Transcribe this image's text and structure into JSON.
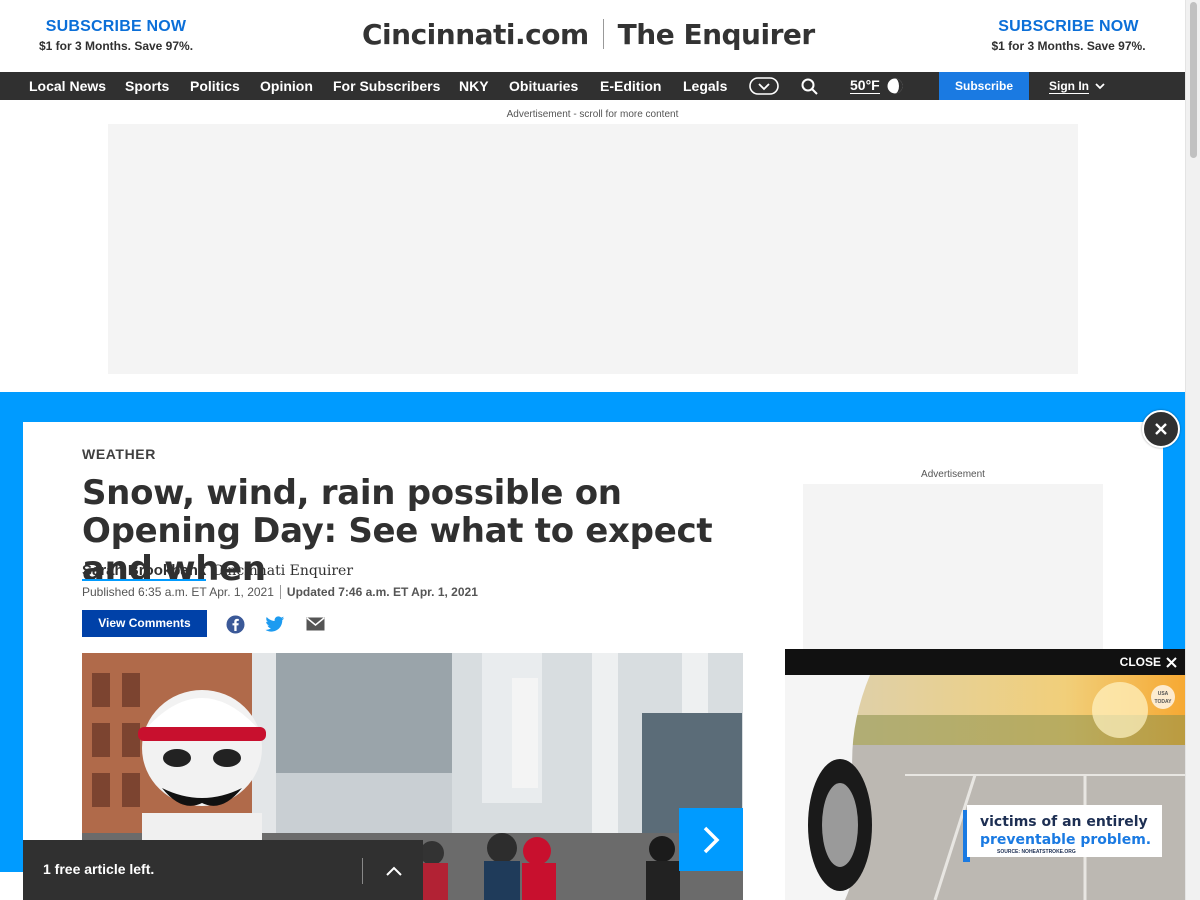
{
  "masthead": {
    "promo_left": {
      "title": "SUBSCRIBE NOW",
      "subtitle": "$1 for 3 Months. Save 97%."
    },
    "promo_right": {
      "title": "SUBSCRIBE NOW",
      "subtitle": "$1 for 3 Months. Save 97%."
    },
    "brand_primary": "Cincinnati.com",
    "brand_secondary": "The Enquirer"
  },
  "nav": {
    "items": [
      "Local News",
      "Sports",
      "Politics",
      "Opinion",
      "For Subscribers",
      "NKY",
      "Obituaries",
      "E-Edition",
      "Legals"
    ],
    "more_icon": "more-toggle-icon",
    "search_icon": "search-icon",
    "weather": {
      "temp": "50°F",
      "icon": "partly-cloudy-icon"
    },
    "subscribe_label": "Subscribe",
    "signin_label": "Sign In"
  },
  "ads": {
    "top_label": "Advertisement - scroll for more content",
    "side_label": "Advertisement"
  },
  "article": {
    "section": "WEATHER",
    "headline": "Snow, wind, rain possible on Opening Day: See what to expect and when",
    "author": "Sarah Brookbank",
    "organization": "Cincinnati Enquirer",
    "published": "Published 6:35 a.m. ET Apr. 1, 2021",
    "updated": "Updated 7:46 a.m. ET Apr. 1, 2021",
    "comments_label": "View Comments",
    "share_icons": [
      "facebook-icon",
      "twitter-icon",
      "email-icon"
    ]
  },
  "video": {
    "close_label": "CLOSE",
    "caption_line1": "victims of an entirely",
    "caption_line2": "preventable problem.",
    "caption_source": "SOURCE: NOHEATSTROKE.ORG",
    "badge": "USA TODAY"
  },
  "paywall": {
    "text": "1 free article left."
  },
  "colors": {
    "accent_blue": "#009bff",
    "nav_dark": "#303030",
    "subscribe_blue": "#1a7ae2",
    "comments_blue": "#0041a8"
  }
}
